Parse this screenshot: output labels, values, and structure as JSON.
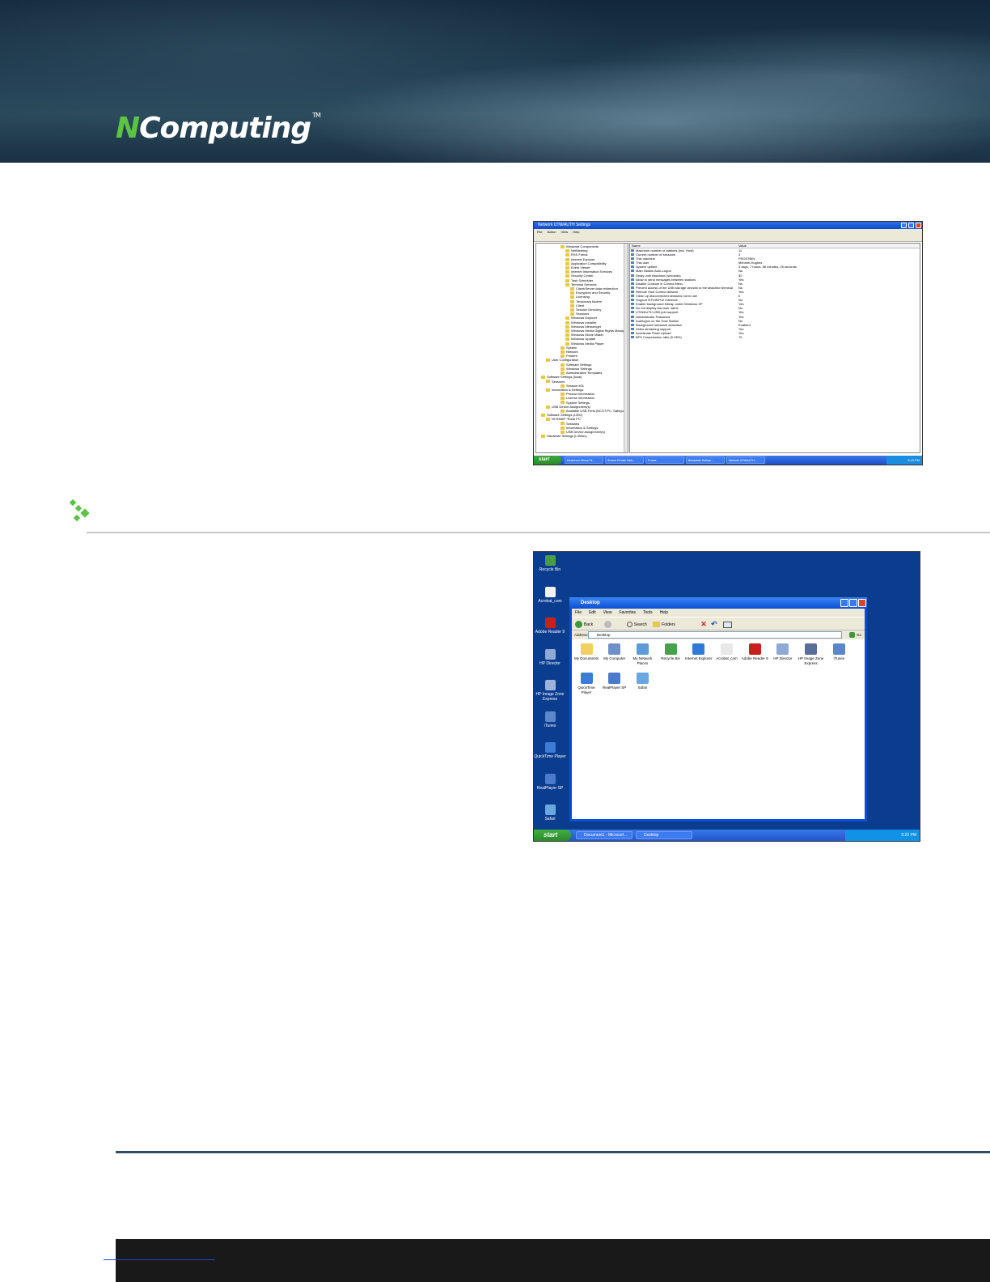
{
  "brand": {
    "logo_n": "N",
    "logo_rest": "Computing",
    "tm": "TM"
  },
  "window1": {
    "title": "Network UTM/AUTH Settings",
    "menu": [
      "File",
      "Action",
      "View",
      "Help"
    ],
    "tree": [
      {
        "t": "Windows Components",
        "i": 2
      },
      {
        "t": "NetMeeting",
        "i": 3
      },
      {
        "t": "RSS Feeds",
        "i": 3
      },
      {
        "t": "Internet Explorer",
        "i": 3
      },
      {
        "t": "Application Compatibility",
        "i": 3
      },
      {
        "t": "Event Viewer",
        "i": 3
      },
      {
        "t": "Internet Information Services",
        "i": 3
      },
      {
        "t": "Security Center",
        "i": 3
      },
      {
        "t": "Task Scheduler",
        "i": 3
      },
      {
        "t": "Terminal Services",
        "i": 3
      },
      {
        "t": "Client/Server data redirection",
        "i": 4
      },
      {
        "t": "Encryption and Security",
        "i": 4
      },
      {
        "t": "Licensing",
        "i": 4
      },
      {
        "t": "Temporary folders",
        "i": 4
      },
      {
        "t": "Client",
        "i": 4
      },
      {
        "t": "Session Directory",
        "i": 4
      },
      {
        "t": "Sessions",
        "i": 4
      },
      {
        "t": "Windows Explorer",
        "i": 3
      },
      {
        "t": "Windows Installer",
        "i": 3
      },
      {
        "t": "Windows Messenger",
        "i": 3
      },
      {
        "t": "Windows Media Digital Rights Management",
        "i": 3
      },
      {
        "t": "Windows Movie Maker",
        "i": 3
      },
      {
        "t": "Windows Update",
        "i": 3
      },
      {
        "t": "Windows Media Player",
        "i": 3
      },
      {
        "t": "System",
        "i": 2
      },
      {
        "t": "Network",
        "i": 2
      },
      {
        "t": "Printers",
        "i": 2
      },
      {
        "t": "User Configuration",
        "i": 1
      },
      {
        "t": "Software Settings",
        "i": 2
      },
      {
        "t": "Windows Settings",
        "i": 2
      },
      {
        "t": "Administrative Templates",
        "i": 2
      },
      {
        "t": "Software Settings (local)",
        "i": 0
      },
      {
        "t": "Sessions",
        "i": 1
      },
      {
        "t": "Session #01",
        "i": 2
      },
      {
        "t": "Information & Settings",
        "i": 1
      },
      {
        "t": "Product Information",
        "i": 2
      },
      {
        "t": "License Information",
        "i": 2
      },
      {
        "t": "System Settings",
        "i": 2
      },
      {
        "t": "USB Device Assignment(s)",
        "i": 1
      },
      {
        "t": "Available USB Ports (NCST-PC, Safeguard dongle)",
        "i": 2
      },
      {
        "t": "Software Settings (L300)",
        "i": 0
      },
      {
        "t": "NCSMAP \"Rural PC\"",
        "i": 1
      },
      {
        "t": "Sessions",
        "i": 2
      },
      {
        "t": "Information & Settings",
        "i": 2
      },
      {
        "t": "USB Device Assignment(s)",
        "i": 2
      },
      {
        "t": "Hardware Settings (L300sv)",
        "i": 0
      }
    ],
    "columns": [
      "Name",
      "Value"
    ],
    "rows": [
      [
        "Maximum number of stations (incl. Host)",
        "11"
      ],
      [
        "Current number of sessions",
        "3"
      ],
      [
        "This machine",
        "FROSTBIN"
      ],
      [
        "This user",
        "Mehmet.Hughes"
      ],
      [
        "System uptime",
        "3 days, 7 hours, 56 minutes, 25 seconds"
      ],
      [
        "Main Station Auto-Logon",
        "No"
      ],
      [
        "Delay until shutdown (seconds)",
        "30"
      ],
      [
        "Allow to send messages between stations",
        "Yes"
      ],
      [
        "Disable Console in Control Menu",
        "No"
      ],
      [
        "Prevent access of the USB storage devices to the attached terminal",
        "No"
      ],
      [
        "Remote Host Control allowed",
        "Yes"
      ],
      [
        "Clean up disconnected sessions not in use",
        "0"
      ],
      [
        "Support NTGINFO2 interface",
        "No"
      ],
      [
        "Enable background bitmap under Windows XP",
        "Yes"
      ],
      [
        "Do not display last user name",
        "No"
      ],
      [
        "UTM/AUTH USB port support",
        "Yes"
      ],
      [
        "Administrator Password",
        "Yes"
      ],
      [
        "Autologon on the Host Station",
        "No"
      ],
      [
        "Background hardware activation",
        "Enabled"
      ],
      [
        "Video streaming support",
        "Yes"
      ],
      [
        "Accelerate Flash Upload",
        "Yes"
      ],
      [
        "BFS Compression ratio (0-95%)",
        "70"
      ]
    ],
    "taskbar": {
      "start": "start",
      "items": [
        "Devices in Minus Fil...",
        "Screen Private Web...",
        "iTunes",
        "Bluepixels Softwa...",
        "Network UTM/AUTH..."
      ],
      "tray": "9:15 PM"
    }
  },
  "window2": {
    "desktop_icons": [
      {
        "label": "Recycle Bin",
        "color": "#4a9b4a"
      },
      {
        "label": "Acrobat_com",
        "color": "#f2f2f2"
      },
      {
        "label": "Adobe Reader 9",
        "color": "#c8201c"
      },
      {
        "label": "HP Director",
        "color": "#8fa9d6"
      },
      {
        "label": "HP Image Zone Express",
        "color": "#9cb2d8"
      },
      {
        "label": "iTunes",
        "color": "#5b88c9"
      },
      {
        "label": "QuickTime Player",
        "color": "#3d7bd6"
      },
      {
        "label": "RealPlayer SP",
        "color": "#4a7ac9"
      },
      {
        "label": "Safari",
        "color": "#6aa6e0"
      }
    ],
    "title": "Desktop",
    "menu": [
      "File",
      "Edit",
      "View",
      "Favorites",
      "Tools",
      "Help"
    ],
    "toolbar": {
      "back": "Back",
      "search": "Search",
      "folders": "Folders"
    },
    "address_label": "Address",
    "address_value": "Desktop",
    "go": "Go",
    "files": [
      {
        "label": "My Documents",
        "color": "#f0d060"
      },
      {
        "label": "My Computer",
        "color": "#6f8fc8"
      },
      {
        "label": "My Network Places",
        "color": "#5d9ad6"
      },
      {
        "label": "Recycle Bin",
        "color": "#4aa04a"
      },
      {
        "label": "Internet Explorer",
        "color": "#2f7ad6"
      },
      {
        "label": "Acrobat_com",
        "color": "#e8e8e8"
      },
      {
        "label": "Adobe Reader 9",
        "color": "#c8201c"
      },
      {
        "label": "HP Director",
        "color": "#8fa9d6"
      },
      {
        "label": "HP Image Zone Express",
        "color": "#5a6e9a"
      },
      {
        "label": "iTunes",
        "color": "#5b88c9"
      },
      {
        "label": "QuickTime Player",
        "color": "#3d7bd6"
      },
      {
        "label": "RealPlayer SP",
        "color": "#4a7ac9"
      },
      {
        "label": "Safari",
        "color": "#6aa6e0"
      }
    ],
    "taskbar": {
      "start": "start",
      "items": [
        "Document1 - Microsof...",
        "Desktop"
      ],
      "tray": "9:22 PM"
    }
  }
}
